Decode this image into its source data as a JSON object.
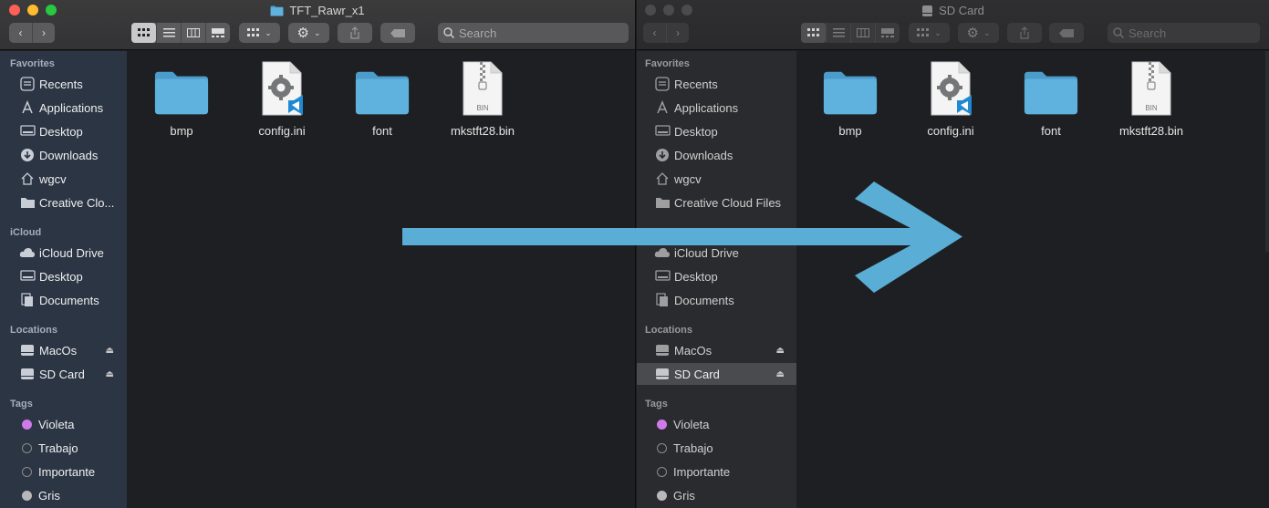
{
  "left_window": {
    "title": "TFT_Rawr_x1",
    "search_placeholder": "Search",
    "sidebar": {
      "favorites_header": "Favorites",
      "favorites": [
        {
          "label": "Recents",
          "icon": "clock-icon"
        },
        {
          "label": "Applications",
          "icon": "applications-icon"
        },
        {
          "label": "Desktop",
          "icon": "desktop-icon"
        },
        {
          "label": "Downloads",
          "icon": "downloads-icon"
        },
        {
          "label": "wgcv",
          "icon": "home-icon"
        },
        {
          "label": "Creative Clo...",
          "icon": "folder-icon"
        }
      ],
      "icloud_header": "iCloud",
      "icloud": [
        {
          "label": "iCloud Drive",
          "icon": "cloud-icon"
        },
        {
          "label": "Desktop",
          "icon": "desktop-icon"
        },
        {
          "label": "Documents",
          "icon": "documents-icon"
        }
      ],
      "locations_header": "Locations",
      "locations": [
        {
          "label": "MacOs",
          "icon": "disk-icon"
        },
        {
          "label": "SD Card",
          "icon": "disk-icon"
        }
      ],
      "tags_header": "Tags",
      "tags": [
        {
          "label": "Violeta",
          "color": "#cf7ae9"
        },
        {
          "label": "Trabajo",
          "color": "none"
        },
        {
          "label": "Importante",
          "color": "none"
        },
        {
          "label": "Gris",
          "color": "#b8b8ba"
        }
      ]
    },
    "files": [
      {
        "name": "bmp",
        "type": "folder"
      },
      {
        "name": "config.ini",
        "type": "ini-file"
      },
      {
        "name": "font",
        "type": "folder"
      },
      {
        "name": "mkstft28.bin",
        "type": "bin-file",
        "badge": "BIN"
      }
    ]
  },
  "right_window": {
    "title": "SD Card",
    "search_placeholder": "Search",
    "sidebar": {
      "favorites_header": "Favorites",
      "favorites": [
        {
          "label": "Recents",
          "icon": "clock-icon"
        },
        {
          "label": "Applications",
          "icon": "applications-icon"
        },
        {
          "label": "Desktop",
          "icon": "desktop-icon"
        },
        {
          "label": "Downloads",
          "icon": "downloads-icon"
        },
        {
          "label": "wgcv",
          "icon": "home-icon"
        },
        {
          "label": "Creative Cloud Files",
          "icon": "folder-icon"
        }
      ],
      "icloud": [
        {
          "label": "iCloud Drive",
          "icon": "cloud-icon"
        },
        {
          "label": "Desktop",
          "icon": "desktop-icon"
        },
        {
          "label": "Documents",
          "icon": "documents-icon"
        }
      ],
      "locations_header": "Locations",
      "locations": [
        {
          "label": "MacOs",
          "icon": "disk-icon"
        },
        {
          "label": "SD Card",
          "icon": "disk-icon",
          "selected": true
        }
      ],
      "tags_header": "Tags",
      "tags": [
        {
          "label": "Violeta",
          "color": "#cf7ae9"
        },
        {
          "label": "Trabajo",
          "color": "none"
        },
        {
          "label": "Importante",
          "color": "none"
        },
        {
          "label": "Gris",
          "color": "#b8b8ba"
        }
      ]
    },
    "files": [
      {
        "name": "bmp",
        "type": "folder"
      },
      {
        "name": "config.ini",
        "type": "ini-file"
      },
      {
        "name": "font",
        "type": "folder"
      },
      {
        "name": "mkstft28.bin",
        "type": "bin-file",
        "badge": "BIN"
      }
    ]
  },
  "overlay": {
    "arrow_color": "#5aaed6",
    "icon": "right-arrow-icon"
  },
  "colors": {
    "folder": "#5fb2dd",
    "sidebar_left": "#2b3544",
    "sidebar_right": "#2a2b2e",
    "vscode_badge": "#1f8ad2"
  }
}
